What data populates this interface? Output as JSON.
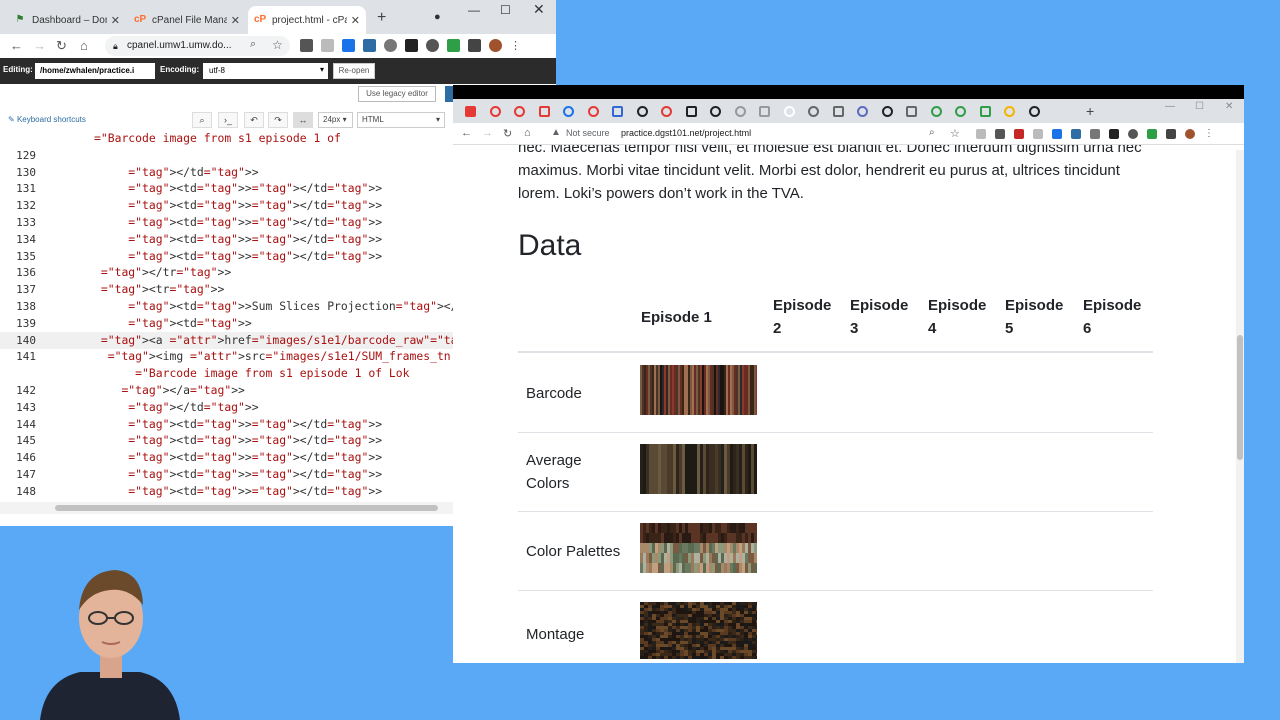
{
  "left_browser": {
    "tabs": [
      {
        "label": "Dashboard – Doma",
        "icon": "wp-icon"
      },
      {
        "label": "cPanel File Manag",
        "icon": "cpanel-icon"
      },
      {
        "label": "project.html - cPan",
        "icon": "cpanel-icon",
        "active": true
      }
    ],
    "url": "cpanel.umw1.umw.do..."
  },
  "editor": {
    "editing_label": "Editing:",
    "path": "/home/zwhalen/practice.i",
    "encoding_label": "Encoding:",
    "encoding_value": "utf-8",
    "reopen_label": "Re-open",
    "legacy_label": "Use legacy editor",
    "keyboard_shortcuts": "Keyboard shortcuts",
    "font_size": "24px",
    "mode": "HTML",
    "lines": [
      {
        "n": "",
        "text": "       =\"Barcode image from s1 episode 1 of"
      },
      {
        "n": "129",
        "text": ""
      },
      {
        "n": "130",
        "text": "            </td>"
      },
      {
        "n": "131",
        "text": "            <td></td>"
      },
      {
        "n": "132",
        "text": "            <td></td>"
      },
      {
        "n": "133",
        "text": "            <td></td>"
      },
      {
        "n": "134",
        "text": "            <td></td>"
      },
      {
        "n": "135",
        "text": "            <td></td>"
      },
      {
        "n": "136",
        "text": "        </tr>"
      },
      {
        "n": "137",
        "text": "        <tr>"
      },
      {
        "n": "138",
        "text": "            <td>Sum Slices Projection</td>"
      },
      {
        "n": "139",
        "text": "            <td>"
      },
      {
        "n": "140",
        "text": "        <a href=\"images/s1e1/barcode_raw\">"
      },
      {
        "n": "141",
        "text": "         <img src=\"images/s1e1/SUM_frames_tn.png\" wid"
      },
      {
        "n": "",
        "text": "             =\"Barcode image from s1 episode 1 of Lok"
      },
      {
        "n": "142",
        "text": "           </a>"
      },
      {
        "n": "143",
        "text": "            </td>"
      },
      {
        "n": "144",
        "text": "            <td></td>"
      },
      {
        "n": "145",
        "text": "            <td></td>"
      },
      {
        "n": "146",
        "text": "            <td></td>"
      },
      {
        "n": "147",
        "text": "            <td></td>"
      },
      {
        "n": "148",
        "text": "            <td></td>"
      },
      {
        "n": "149",
        "text": ""
      }
    ]
  },
  "right_browser": {
    "not_secure": "Not secure",
    "url": "practice.dgst101.net/project.html"
  },
  "page": {
    "paragraph": "nec. Maecenas tempor nisi velit, et molestie est blandit et. Donec interdum dignissim urna nec maximus. Morbi vitae tincidunt velit. Morbi est dolor, hendrerit eu purus at, ultrices tincidunt lorem. Loki’s powers don’t work in the TVA.",
    "heading": "Data",
    "columns": [
      "Episode 1",
      "Episode 2",
      "Episode 3",
      "Episode 4",
      "Episode 5",
      "Episode 6"
    ],
    "rows": [
      {
        "label": "Barcode",
        "image": "barcode"
      },
      {
        "label": "Average Colors",
        "image": "average"
      },
      {
        "label": "Color Palettes",
        "image": "palette"
      },
      {
        "label": "Montage",
        "image": "montage"
      }
    ]
  },
  "colors": {
    "cpanel_orange": "#ff6c2c",
    "editor_bar": "#2b2b2b",
    "desktop_blue": "#5aa9f6"
  }
}
